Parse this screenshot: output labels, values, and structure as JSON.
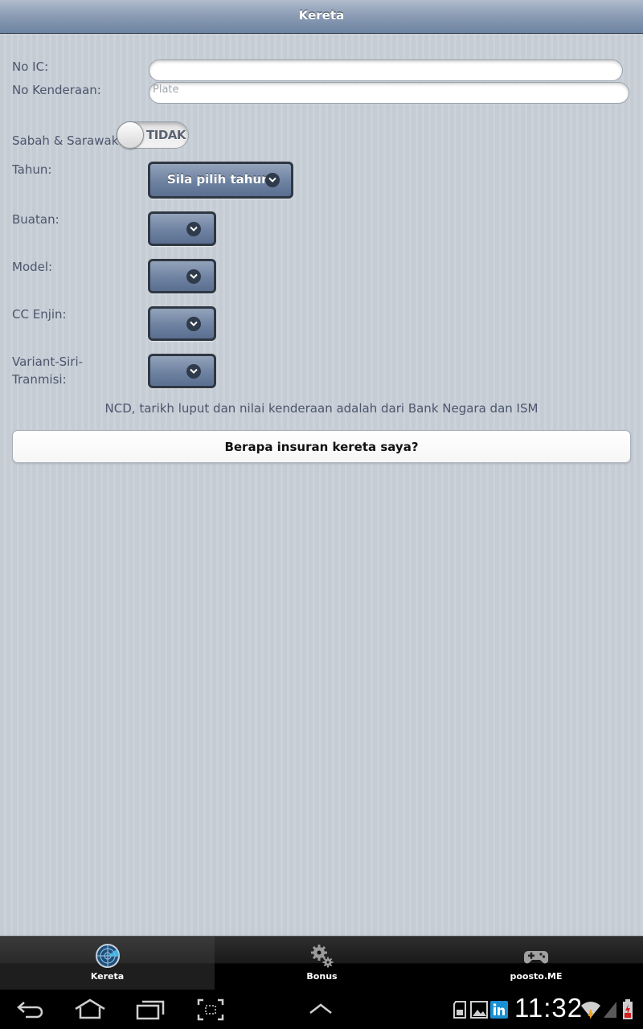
{
  "header": {
    "title": "Kereta"
  },
  "form": {
    "ic_label": "No IC:",
    "ic_value": "",
    "plate_label": "No Kenderaan:",
    "plate_placeholder": "Plate",
    "region_label": "Sabah & Sarawak:",
    "region_toggle_text": "TIDAK",
    "year_label": "Tahun:",
    "year_select_text": "Sila pilih tahun",
    "make_label": "Buatan:",
    "model_label": "Model:",
    "cc_label": "CC Enjin:",
    "variant_label_line1": "Variant-Siri-",
    "variant_label_line2": "Tranmisi:"
  },
  "note": "NCD, tarikh luput dan nilai kenderaan adalah dari Bank Negara dan ISM",
  "main_button_label": "Berapa insuran kereta saya?",
  "tabs": [
    {
      "label": "Kereta",
      "icon": "radar-globe-icon",
      "active": true
    },
    {
      "label": "Bonus",
      "icon": "gears-icon",
      "active": false
    },
    {
      "label": "poosto.ME",
      "icon": "gamepad-icon",
      "active": false
    }
  ],
  "system_bar": {
    "time": "11:32",
    "icons": [
      "back-icon",
      "home-icon",
      "recent-apps-icon",
      "screenshot-icon",
      "menu-up-icon",
      "sd-card-icon",
      "gallery-icon",
      "linkedin-icon",
      "wifi-icon",
      "signal-icon",
      "battery-icon"
    ]
  },
  "colors": {
    "header": "#8a9ab3",
    "background": "#c5ccd4",
    "select": "#6e82a1",
    "tabbar": "#000000"
  }
}
